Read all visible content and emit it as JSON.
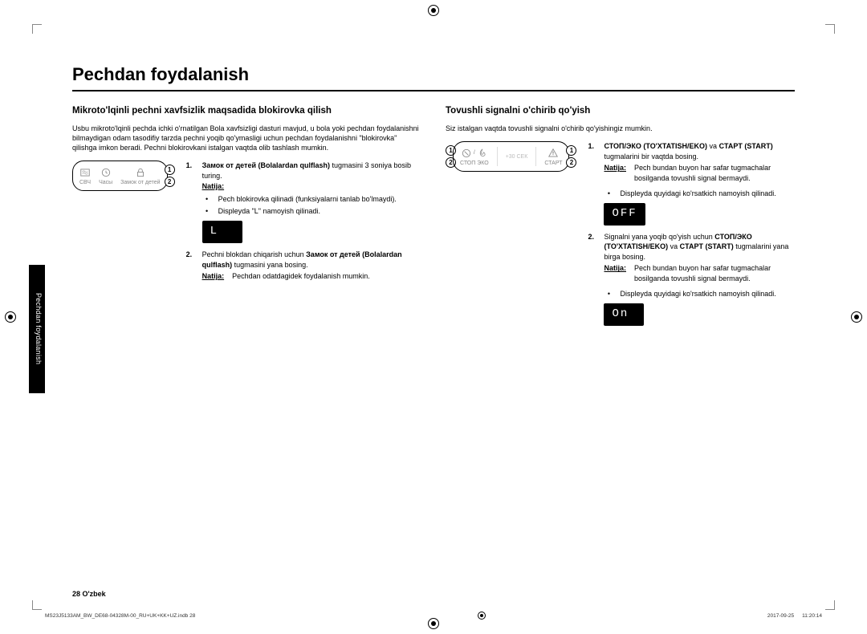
{
  "page_title": "Pechdan foydalanish",
  "side_tab": "Pechdan foydalanish",
  "left": {
    "heading": "Mikroto'lqinli pechni xavfsizlik maqsadida blokirovka qilish",
    "intro": "Usbu mikroto'lqinli pechda ichki o'rnatilgan Bola xavfsizligi dasturi mavjud, u bola yoki pechdan foydalanishni bilmaydigan odam tasodifiy tarzda pechni yoqib qo'ymasligi uchun pechdan foydalanishni \"blokirovka\" qilishga imkon beradi. Pechni blokirovkani istalgan vaqtda olib tashlash mumkin.",
    "panel": {
      "svch": "СВЧ",
      "chasy": "Часы",
      "zamok": "Замок от детей"
    },
    "step1_num": "1.",
    "step1_a": "Замок от детей (Bolalardan qulflash)",
    "step1_b": " tugmasini 3 soniya bosib turing.",
    "natija_label": "Natija:",
    "step1_bul1": "Pech blokirovka qilinadi (funksiyalarni tanlab bo'lmaydi).",
    "step1_bul2": "Displeyda \"L\" namoyish qilinadi.",
    "display1": "L",
    "step2_num": "2.",
    "step2_a": "Pechni blokdan chiqarish uchun ",
    "step2_b": "Замок от детей (Bolalardan qulflash)",
    "step2_c": " tugmasini yana bosing.",
    "step2_natija_txt": "Pechdan odatdagidek foydalanish mumkin."
  },
  "right": {
    "heading": "Tovushli signalni o'chirib qo'yish",
    "intro": "Siz istalgan vaqtda tovushli signalni o'chirib qo'yishingiz mumkin.",
    "panel": {
      "stop_eko": "СТОП   ЭКО",
      "plus30": "+30 СЕК",
      "start": "СТАРТ"
    },
    "step1_num": "1.",
    "step1_a": "СТОП/ЭКО (TO'XTATISH/EKO)",
    "step1_mid": " va ",
    "step1_b": "CTAPT (START)",
    "step1_c": " tugmalarini bir vaqtda bosing.",
    "natija_label": "Natija:",
    "step1_natija_txt": "Pech bundan buyon har safar tugmachalar bosilganda tovushli signal bermaydi.",
    "step1_bul": "Displeyda quyidagi ko'rsatkich namoyish qilinadi.",
    "display1": "OFF",
    "step2_num": "2.",
    "step2_a": "Signalni yana yoqib qo'yish uchun ",
    "step2_b": "СТОП/ЭКО (TO'XTATISH/EKO)",
    "step2_mid": " va ",
    "step2_c": "CTAPT (START)",
    "step2_d": " tugmalarini yana birga bosing.",
    "step2_natija_txt": "Pech bundan buyon har safar tugmachalar bosilganda tovushli signal bermaydi.",
    "step2_bul": "Displeyda quyidagi ko'rsatkich namoyish qilinadi.",
    "display2": "On"
  },
  "footer": "28  O'zbek",
  "jobfile": "MS23J5133AM_BW_DE68-04328M-00_RU+UK+KK+UZ.indb   28",
  "jobdate": "2017-09-25",
  "jobtime": "11:20:14"
}
